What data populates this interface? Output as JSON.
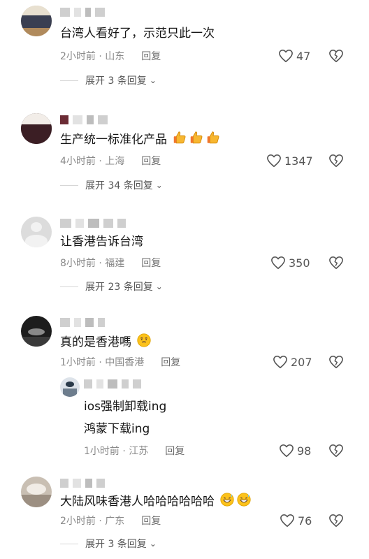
{
  "comments": [
    {
      "text": "台湾人看好了，示范只此一次",
      "time_location": "2小时前 · 山东",
      "reply_label": "回复",
      "likes": "47",
      "expand_label": "展开 3 条回复"
    },
    {
      "text": "生产统一标准化产品",
      "emoji": [
        "thumbs-up",
        "thumbs-up",
        "thumbs-up"
      ],
      "time_location": "4小时前 · 上海",
      "reply_label": "回复",
      "likes": "1347",
      "expand_label": "展开 34 条回复"
    },
    {
      "text": "让香港告诉台湾",
      "time_location": "8小时前 · 福建",
      "reply_label": "回复",
      "likes": "350",
      "expand_label": "展开 23 条回复"
    },
    {
      "text": "真的是香港嗎",
      "emoji": [
        "thinking-face"
      ],
      "time_location": "1小时前 · 中国香港",
      "reply_label": "回复",
      "likes": "207",
      "reply": {
        "text_line1": "ios强制卸载ing",
        "text_line2": "鸿蒙下载ing",
        "time_location": "1小时前 · 江苏",
        "reply_label": "回复",
        "likes": "98"
      }
    },
    {
      "text": "大陆风味香港人哈哈哈哈哈哈",
      "emoji": [
        "grinning-sweat-face",
        "grinning-sweat-face"
      ],
      "time_location": "2小时前 · 广东",
      "reply_label": "回复",
      "likes": "76",
      "expand_label": "展开 3 条回复"
    }
  ],
  "colors": {
    "text": "#161616",
    "meta": "#8a8a8a",
    "icon": "#555555",
    "divider": "#d6d6d6"
  }
}
